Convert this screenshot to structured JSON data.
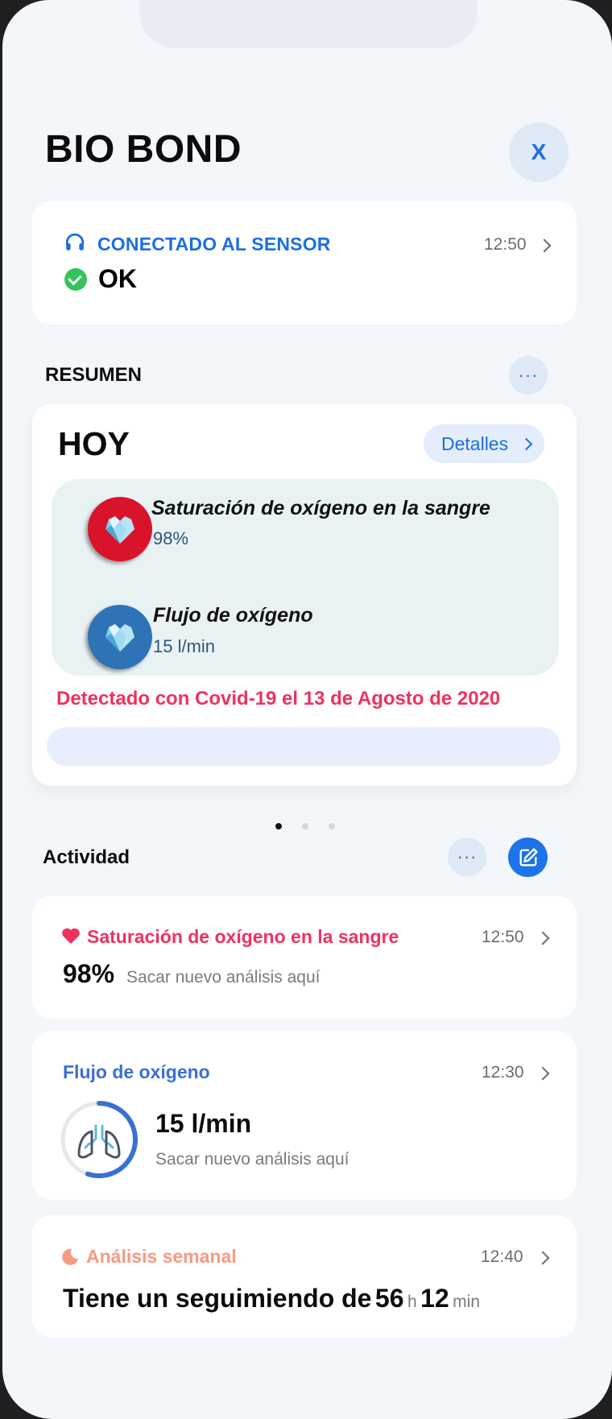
{
  "app": {
    "title": "BIO BOND",
    "close_label": "X"
  },
  "connection": {
    "label": "CONECTADO AL SENSOR",
    "time": "12:50",
    "status": "OK"
  },
  "summary": {
    "section_title": "RESUMEN",
    "more_label": "···",
    "today_label": "HOY",
    "details_label": "Detalles",
    "metrics": [
      {
        "title": "Saturación de oxígeno en la sangre",
        "value": "98%",
        "icon": "heart-gem-icon",
        "color": "#d9142a"
      },
      {
        "title": "Flujo de oxígeno",
        "value": "15 l/min",
        "icon": "heart-gem-icon",
        "color": "#2f73b7"
      }
    ],
    "alert": "Detectado con Covid-19 el 13 de Agosto de 2020",
    "pager": {
      "count": 3,
      "active": 1
    }
  },
  "activity": {
    "section_title": "Actividad",
    "more_label": "···",
    "cards": {
      "saturation": {
        "title": "Saturación de oxígeno en la sangre",
        "time": "12:50",
        "value": "98%",
        "hint": "Sacar nuevo análisis aquí",
        "color": "#f0315f"
      },
      "flow": {
        "title": "Flujo de oxígeno",
        "time": "12:30",
        "value": "15 l/min",
        "hint": "Sacar nuevo análisis aquí",
        "color": "#3b6fd6",
        "progress_fraction": 0.55
      },
      "weekly": {
        "title": "Análisis semanal",
        "time": "12:40",
        "prefix": "Tiene un seguimiendo de",
        "hours": "56",
        "hours_unit": "h",
        "minutes": "12",
        "minutes_unit": "min",
        "color": "#f79a82"
      }
    }
  }
}
